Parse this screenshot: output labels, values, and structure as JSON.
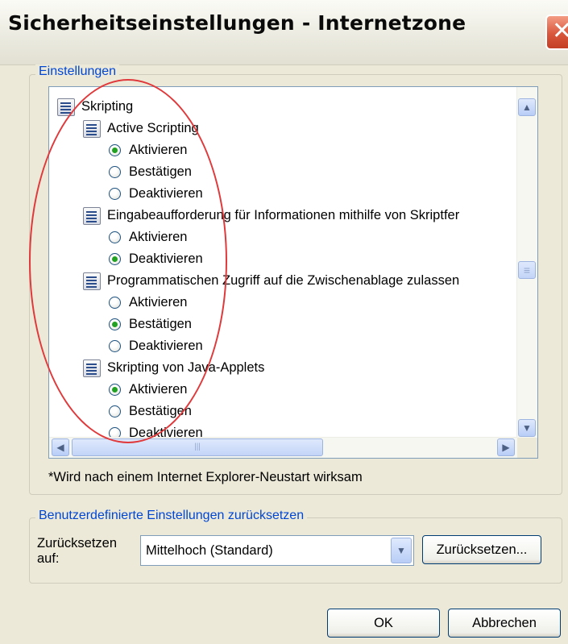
{
  "window": {
    "title": "Sicherheitseinstellungen - Internetzone",
    "close_glyph": "✕",
    "close_icon": "close-icon"
  },
  "settings_group": {
    "label": "Einstellungen",
    "tree": [
      {
        "kind": "category",
        "text": "Skripting",
        "icon": "script-settings-icon"
      },
      {
        "kind": "setting",
        "text": "Active Scripting",
        "icon": "script-settings-icon"
      },
      {
        "kind": "option",
        "text": "Aktivieren",
        "selected": true
      },
      {
        "kind": "option",
        "text": "Bestätigen",
        "selected": false
      },
      {
        "kind": "option",
        "text": "Deaktivieren",
        "selected": false
      },
      {
        "kind": "setting",
        "text": "Eingabeaufforderung für Informationen mithilfe von Skriptfer",
        "icon": "script-settings-icon"
      },
      {
        "kind": "option",
        "text": "Aktivieren",
        "selected": false
      },
      {
        "kind": "option",
        "text": "Deaktivieren",
        "selected": true
      },
      {
        "kind": "setting",
        "text": "Programmatischen Zugriff auf die Zwischenablage zulassen",
        "icon": "script-settings-icon"
      },
      {
        "kind": "option",
        "text": "Aktivieren",
        "selected": false
      },
      {
        "kind": "option",
        "text": "Bestätigen",
        "selected": true
      },
      {
        "kind": "option",
        "text": "Deaktivieren",
        "selected": false
      },
      {
        "kind": "setting",
        "text": "Skripting von Java-Applets",
        "icon": "script-settings-icon"
      },
      {
        "kind": "option",
        "text": "Aktivieren",
        "selected": true
      },
      {
        "kind": "option",
        "text": "Bestätigen",
        "selected": false
      },
      {
        "kind": "option",
        "text": "Deaktivieren",
        "selected": false
      }
    ],
    "scroll_up_glyph": "▲",
    "scroll_down_glyph": "▼",
    "scroll_left_glyph": "◀",
    "scroll_right_glyph": "▶",
    "grip_glyph": "≡",
    "hgrip_glyph": "|||",
    "note": "*Wird nach einem Internet Explorer-Neustart wirksam"
  },
  "reset_group": {
    "label": "Benutzerdefinierte Einstellungen zurücksetzen",
    "field_label": "Zurücksetzen auf:",
    "select_value": "Mittelhoch (Standard)",
    "dropdown_glyph": "▼",
    "reset_button": "Zurücksetzen..."
  },
  "footer": {
    "ok": "OK",
    "cancel": "Abbrechen"
  },
  "annotation": {
    "color": "#e0393b"
  }
}
